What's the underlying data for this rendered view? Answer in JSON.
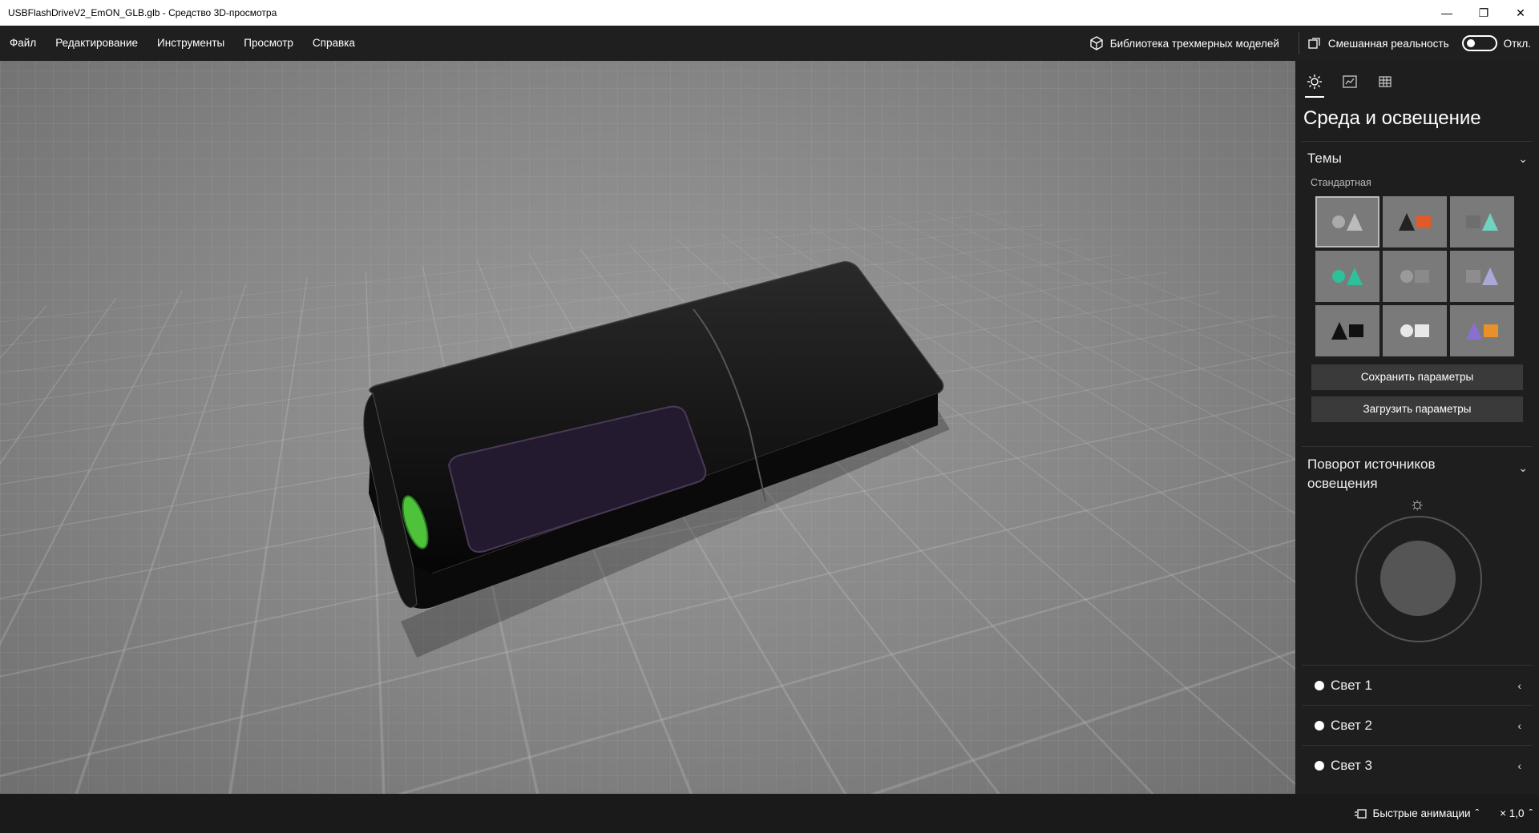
{
  "window": {
    "title": "USBFlashDriveV2_EmON_GLB.glb - Средство 3D-просмотра",
    "minimize_glyph": "—",
    "maximize_glyph": "❐",
    "close_glyph": "✕"
  },
  "menu": {
    "items": [
      "Файл",
      "Редактирование",
      "Инструменты",
      "Просмотр",
      "Справка"
    ],
    "library_label": "Библиотека трехмерных моделей",
    "mixed_reality_label": "Смешанная реальность",
    "mixed_reality_state": "Откл."
  },
  "panel": {
    "title": "Среда и освещение",
    "themes": {
      "heading": "Темы",
      "subheading": "Стандартная",
      "tile_colors": [
        "#8a8a8a",
        "#e05a2a",
        "#6fd3c0",
        "#2fbf9a",
        "#9a9a9a",
        "#a9a9d8",
        "#111111",
        "#e8e8e8",
        "#e8902a"
      ]
    },
    "save_button": "Сохранить параметры",
    "load_button": "Загрузить параметры",
    "rotation_heading": "Поворот источников освещения",
    "lights": [
      "Свет 1",
      "Свет 2",
      "Свет 3"
    ]
  },
  "bottom": {
    "animations_label": "Быстрые анимации",
    "speed_label": "× 1,0"
  }
}
